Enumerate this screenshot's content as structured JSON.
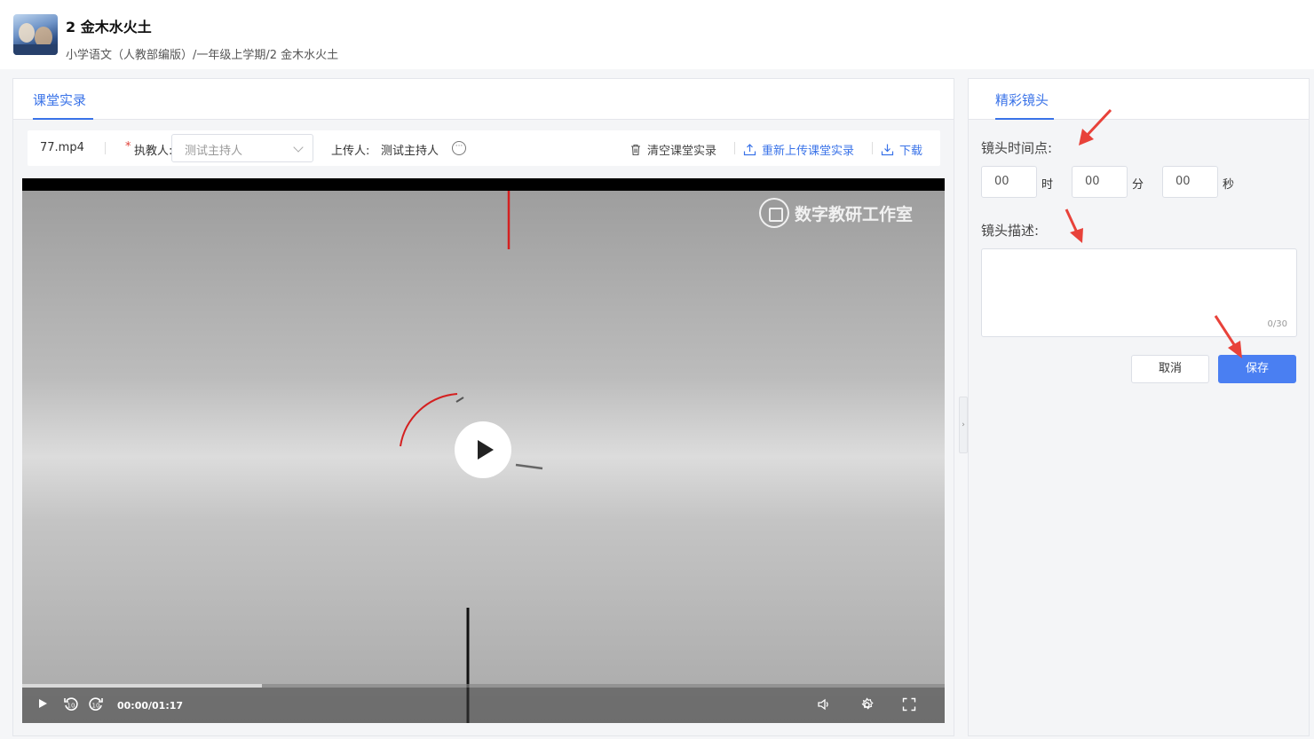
{
  "header": {
    "title": "2 金木水火土",
    "breadcrumb": "小学语文（人教部编版）/一年级上学期/2 金木水火土"
  },
  "left_panel": {
    "tab_label": "课堂实录",
    "toolbar": {
      "file_name": "77.mp4",
      "required_mark": "*",
      "teacher_label": "执教人:",
      "teacher_placeholder": "测试主持人",
      "uploader_label": "上传人:",
      "uploader_name": "测试主持人",
      "clear_label": "清空课堂实录",
      "reupload_label": "重新上传课堂实录",
      "download_label": "下载"
    },
    "video": {
      "watermark": "数字教研工作室",
      "time": "00:00/01:17",
      "progress": 0.26,
      "skip_back_label": "10",
      "skip_forward_label": "10"
    }
  },
  "right_panel": {
    "tab_label": "精彩镜头",
    "time_label": "镜头时间点:",
    "hours_value": "00",
    "hours_unit": "时",
    "minutes_value": "00",
    "minutes_unit": "分",
    "seconds_value": "00",
    "seconds_unit": "秒",
    "desc_label": "镜头描述:",
    "desc_count": "0/30",
    "cancel_label": "取消",
    "save_label": "保存"
  },
  "colors": {
    "accent": "#3a73e8",
    "save_button": "#4a7ff2",
    "annotation_arrow": "#e8423a"
  },
  "icons": [
    "trash-icon",
    "upload-icon",
    "download-icon",
    "more-icon",
    "play-icon",
    "replay-10-icon",
    "forward-10-icon",
    "volume-icon",
    "settings-icon",
    "fullscreen-icon",
    "collapse-chevron-icon"
  ]
}
